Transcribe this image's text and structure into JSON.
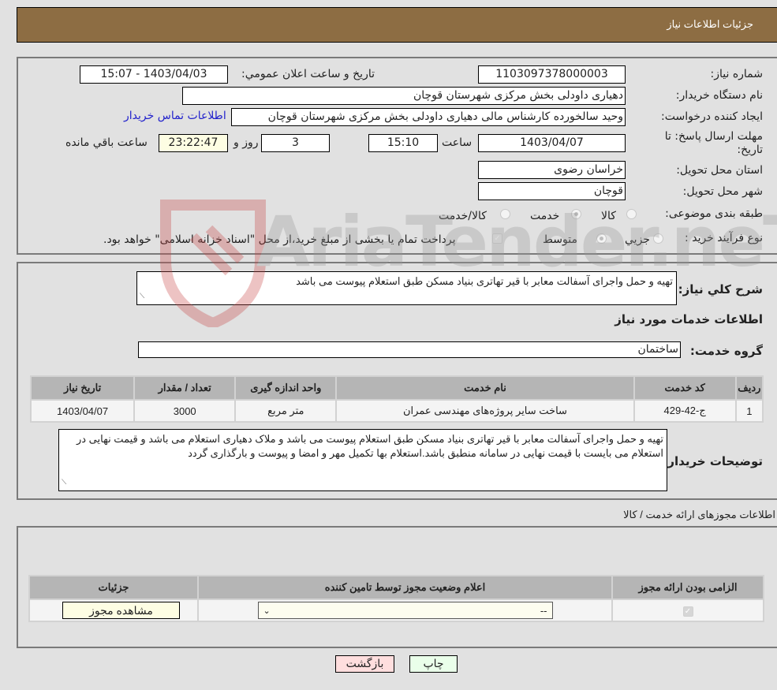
{
  "header": {
    "title": "جزئیات اطلاعات نیاز"
  },
  "info": {
    "need_number_label": "شماره نیاز:",
    "need_number": "1103097378000003",
    "announce_label": "تاریخ و ساعت اعلان عمومي:",
    "announce_value": "1403/04/03 - 15:07",
    "buyer_org_label": "نام دستگاه خریدار:",
    "buyer_org": "دهیاری داودلی بخش مرکزی شهرستان قوچان",
    "requester_label": "ایجاد کننده درخواست:",
    "requester": "وحید سالخورده کارشناس مالی دهیاری داودلی بخش مرکزی شهرستان قوچان",
    "contact_link": "اطلاعات تماس خریدار",
    "deadline_label": "مهلت ارسال پاسخ: تا تاریخ:",
    "deadline_date": "1403/04/07",
    "time_label": "ساعت",
    "deadline_time": "15:10",
    "days": "3",
    "days_label": "روز و",
    "remaining": "23:22:47",
    "remaining_label": "ساعت باقي مانده",
    "province_label": "استان محل تحویل:",
    "province": "خراسان رضوی",
    "city_label": "شهر محل تحویل:",
    "city": "قوچان",
    "category_label": "طبقه بندی موضوعی:",
    "category_options": [
      {
        "label": "کالا",
        "selected": false
      },
      {
        "label": "خدمت",
        "selected": true
      },
      {
        "label": "کالا/خدمت",
        "selected": false
      }
    ],
    "process_label": "نوع فرآیند خرید :",
    "process_options": [
      {
        "label": "جزيي",
        "selected": false
      },
      {
        "label": "متوسط",
        "selected": true
      }
    ],
    "treasury_checkbox_label": "پرداخت تمام یا بخشی از مبلغ خرید،از محل \"اسناد خزانه اسلامی\" خواهد بود.",
    "treasury_checked": true
  },
  "details": {
    "description_label": "شرح کلي نياز:",
    "description": "تهیه و حمل واجرای آسفالت معابر با قیر تهاتری بنیاد مسکن طبق استعلام پیوست می باشد",
    "services_heading": "اطلاعات خدمات مورد نياز",
    "service_group_label": "گروه خدمت:",
    "service_group": "ساختمان",
    "table": {
      "headers": [
        "ردیف",
        "کد خدمت",
        "نام خدمت",
        "واحد اندازه گیری",
        "تعداد / مقدار",
        "تاریخ نیاز"
      ],
      "rows": [
        [
          "1",
          "ج-42-429",
          "ساخت سایر پروژه‌های مهندسی عمران",
          "متر مربع",
          "3000",
          "1403/04/07"
        ]
      ]
    },
    "buyer_notes_label": "توضیحات خریدار:",
    "buyer_notes": "تهیه و حمل واجرای آسفالت معابر با قیر تهاتری بنیاد مسکن طبق استعلام پیوست می باشد و ملاک دهیاری استعلام می باشد و قیمت نهایی در استعلام می بایست با قیمت نهایی در سامانه منطبق باشد.استعلام بها تکمیل مهر و امضا و پیوست و بارگذاری گردد"
  },
  "permits": {
    "section_title": "اطلاعات مجوزهای ارائه خدمت / کالا",
    "headers": [
      "الزامی بودن ارائه مجوز",
      "اعلام وضعیت مجوز توسط تامین کننده",
      "جزئیات"
    ],
    "row": {
      "required": true,
      "status_value": "--",
      "view_button": "مشاهده مجوز"
    }
  },
  "actions": {
    "print": "چاپ",
    "back": "بازگشت"
  },
  "watermark": {
    "text": "AriaTender.neT"
  },
  "colors": {
    "header_bg": "#8d6d43",
    "print_bg": "#eaffea",
    "back_bg": "#ffdede",
    "link": "#2222cc"
  }
}
